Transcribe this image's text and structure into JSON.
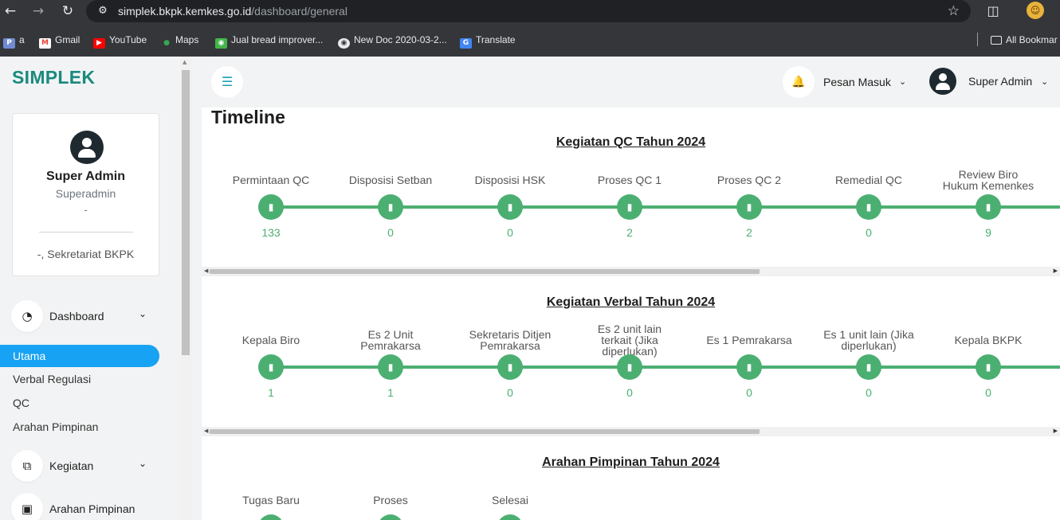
{
  "browser": {
    "url_host": "simplek.bkpk.kemkes.go.id",
    "url_path": "/dashboard/general",
    "bookmarks": [
      {
        "label": "a",
        "icon": "ppm-icon",
        "color": "#6f8bd1"
      },
      {
        "label": "Gmail",
        "icon": "gmail-icon",
        "color": "#ea4335"
      },
      {
        "label": "YouTube",
        "icon": "youtube-icon",
        "color": "#ff0000"
      },
      {
        "label": "Maps",
        "icon": "maps-icon",
        "color": "#34a853"
      },
      {
        "label": "Jual bread improver...",
        "icon": "shop-icon",
        "color": "#42b549"
      },
      {
        "label": "New Doc 2020-03-2...",
        "icon": "globe-icon",
        "color": "#e8eaed"
      },
      {
        "label": "Translate",
        "icon": "translate-icon",
        "color": "#4285f4"
      }
    ],
    "all_bookmarks": "All Bookmar"
  },
  "app": {
    "brand": "SIMPLEK",
    "accent_color": "#17a2f3",
    "timeline_color": "#4caf72"
  },
  "profile": {
    "name": "Super Admin",
    "role": "Superadmin",
    "dash": "-",
    "unit": "-, Sekretariat BKPK"
  },
  "sidebar": {
    "dashboard_label": "Dashboard",
    "sub_items": [
      "Utama",
      "Verbal Regulasi",
      "QC",
      "Arahan Pimpinan"
    ],
    "active_sub": "Utama",
    "kegiatan_label": "Kegiatan",
    "arahan_label": "Arahan Pimpinan"
  },
  "topbar": {
    "messages_label": "Pesan Masuk",
    "user_label": "Super Admin"
  },
  "main": {
    "title": "Timeline",
    "sections": [
      {
        "title": "Kegiatan QC Tahun 2024",
        "stages": [
          {
            "label": "Permintaan QC",
            "count": "133"
          },
          {
            "label": "Disposisi Setban",
            "count": "0"
          },
          {
            "label": "Disposisi HSK",
            "count": "0"
          },
          {
            "label": "Proses QC 1",
            "count": "2"
          },
          {
            "label": "Proses QC 2",
            "count": "2"
          },
          {
            "label": "Remedial QC",
            "count": "0"
          },
          {
            "label": "Review Biro Hukum Kemenkes",
            "count": "9"
          }
        ]
      },
      {
        "title": "Kegiatan Verbal Tahun 2024",
        "stages": [
          {
            "label": "Kepala Biro",
            "count": "1"
          },
          {
            "label": "Es 2 Unit Pemrakarsa",
            "count": "1"
          },
          {
            "label": "Sekretaris Ditjen Pemrakarsa",
            "count": "0"
          },
          {
            "label": "Es 2 unit lain terkait (Jika diperlukan)",
            "count": "0"
          },
          {
            "label": "Es 1 Pemrakarsa",
            "count": "0"
          },
          {
            "label": "Es 1 unit lain (Jika diperlukan)",
            "count": "0"
          },
          {
            "label": "Kepala BKPK",
            "count": "0"
          }
        ]
      },
      {
        "title": "Arahan Pimpinan Tahun 2024",
        "stages": [
          {
            "label": "Tugas Baru",
            "count": ""
          },
          {
            "label": "Proses",
            "count": ""
          },
          {
            "label": "Selesai",
            "count": ""
          }
        ]
      }
    ]
  }
}
